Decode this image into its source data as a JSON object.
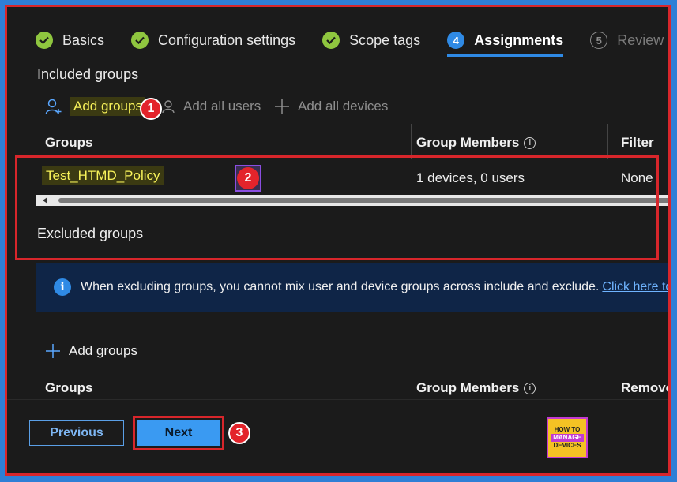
{
  "tabs": [
    {
      "label": "Basics",
      "state": "done"
    },
    {
      "label": "Configuration settings",
      "state": "done"
    },
    {
      "label": "Scope tags",
      "state": "done"
    },
    {
      "label": "Assignments",
      "state": "current",
      "number": "4"
    },
    {
      "label": "Review",
      "state": "upcoming",
      "number": "5"
    }
  ],
  "included": {
    "title": "Included groups",
    "add_groups": "Add groups",
    "add_all_users": "Add all users",
    "add_all_devices": "Add all devices",
    "columns": {
      "groups": "Groups",
      "members": "Group Members",
      "filter": "Filter"
    },
    "rows": [
      {
        "group": "Test_HTMD_Policy",
        "members": "1 devices, 0 users",
        "filter": "None"
      }
    ]
  },
  "excluded": {
    "title": "Excluded groups",
    "info_text": "When excluding groups, you cannot mix user and device groups across include and exclude.",
    "info_link": "Click here to le",
    "add_groups": "Add groups",
    "columns": {
      "groups": "Groups",
      "members": "Group Members",
      "remove": "Remove"
    }
  },
  "footer": {
    "previous": "Previous",
    "next": "Next"
  },
  "annotations": {
    "badge1": "1",
    "badge2": "2",
    "badge3": "3"
  },
  "logo": {
    "line1": "HOW TO",
    "line2": "MANAGE",
    "line3": "DEVICES"
  },
  "colors": {
    "accent": "#2f8ae5",
    "check": "#8fc63f",
    "callout": "#d8262b"
  }
}
